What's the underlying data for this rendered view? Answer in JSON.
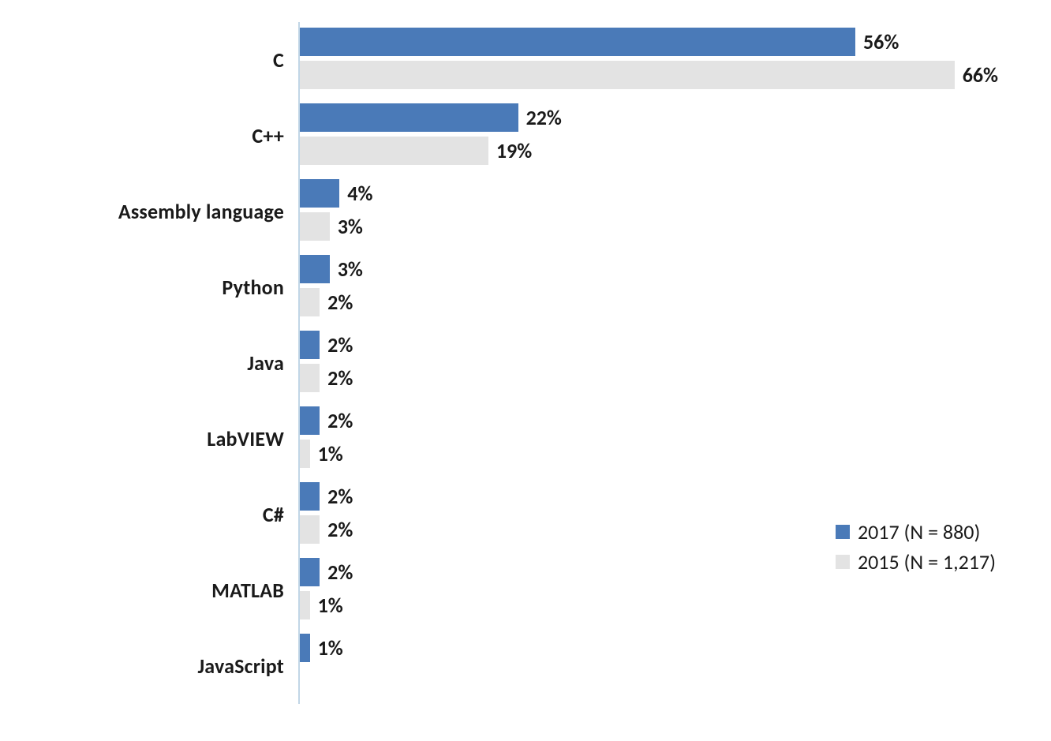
{
  "chart_data": {
    "type": "bar",
    "orientation": "horizontal",
    "categories": [
      "C",
      "C++",
      "Assembly language",
      "Python",
      "Java",
      "LabVIEW",
      "C#",
      "MATLAB",
      "JavaScript"
    ],
    "series": [
      {
        "name": "2017 (N = 880)",
        "color": "#4a7ab8",
        "values": [
          56,
          22,
          4,
          3,
          2,
          2,
          2,
          2,
          1
        ]
      },
      {
        "name": "2015 (N = 1,217)",
        "color": "#e3e3e3",
        "values": [
          66,
          19,
          3,
          2,
          2,
          1,
          2,
          1,
          null
        ]
      }
    ],
    "value_suffix": "%",
    "xlim": [
      0,
      70
    ],
    "title": "",
    "xlabel": "",
    "ylabel": "",
    "legend_position": "bottom-right"
  }
}
